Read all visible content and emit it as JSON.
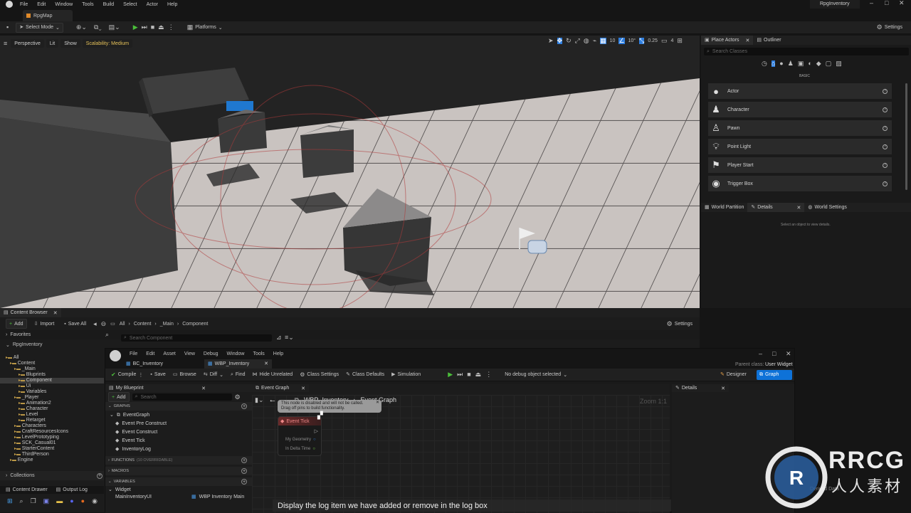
{
  "menubar": {
    "items": [
      "File",
      "Edit",
      "Window",
      "Tools",
      "Build",
      "Select",
      "Actor",
      "Help"
    ],
    "project": "RpgInventory"
  },
  "doc_tab": "RpgMap",
  "toolbar": {
    "select_mode": "Select Mode",
    "platforms": "Platforms",
    "settings": "Settings"
  },
  "viewport": {
    "perspective": "Perspective",
    "lit": "Lit",
    "show": "Show",
    "scalability": "Scalability: Medium",
    "grid_snap": "10",
    "rot_snap": "10°",
    "scale_snap": "0.25",
    "cam_speed": "4"
  },
  "place_actors": {
    "tab": "Place Actors",
    "outliner": "Outliner",
    "search_placeholder": "Search Classes",
    "section": "BASIC",
    "items": [
      {
        "label": "Actor",
        "icon": "actor-icon"
      },
      {
        "label": "Character",
        "icon": "character-icon"
      },
      {
        "label": "Pawn",
        "icon": "pawn-icon"
      },
      {
        "label": "Point Light",
        "icon": "point-light-icon"
      },
      {
        "label": "Player Start",
        "icon": "player-start-icon"
      },
      {
        "label": "Trigger Box",
        "icon": "trigger-box-icon"
      }
    ]
  },
  "lower_right": {
    "tabs": [
      "World Partition",
      "Details",
      "World Settings"
    ],
    "empty": "Select an object to view details."
  },
  "content_browser": {
    "tab": "Content Browser",
    "add": "Add",
    "import": "Import",
    "save_all": "Save All",
    "path": [
      "All",
      "Content",
      "_Main",
      "Component"
    ],
    "settings": "Settings",
    "search_placeholder": "Search Component",
    "favorites": "Favorites",
    "root": "RpgInventory",
    "tree": [
      {
        "label": "All",
        "d": 0
      },
      {
        "label": "Content",
        "d": 1
      },
      {
        "label": "_Main",
        "d": 2
      },
      {
        "label": "Bluprints",
        "d": 3
      },
      {
        "label": "Component",
        "d": 3,
        "sel": true
      },
      {
        "label": "Ui",
        "d": 3
      },
      {
        "label": "Variables",
        "d": 3
      },
      {
        "label": "_Player",
        "d": 2
      },
      {
        "label": "Animation2",
        "d": 3
      },
      {
        "label": "Character",
        "d": 3
      },
      {
        "label": "Level",
        "d": 3
      },
      {
        "label": "Retarget",
        "d": 3
      },
      {
        "label": "Characters",
        "d": 2
      },
      {
        "label": "CraftResourcesIcons",
        "d": 2
      },
      {
        "label": "LevelPrototyping",
        "d": 2
      },
      {
        "label": "SCK_Casual01",
        "d": 2
      },
      {
        "label": "StarterContent",
        "d": 2
      },
      {
        "label": "ThirdPerson",
        "d": 2
      },
      {
        "label": "Engine",
        "d": 1
      }
    ],
    "collections": "Collections",
    "content_drawer": "Content Drawer",
    "output_log": "Output Log"
  },
  "blueprint": {
    "menu": [
      "File",
      "Edit",
      "Asset",
      "View",
      "Debug",
      "Window",
      "Tools",
      "Help"
    ],
    "parent_class_label": "Parent class:",
    "parent_class": "User Widget",
    "tabs": [
      "BC_Inventory",
      "WBP_Inventory"
    ],
    "toolbar": [
      "Compile",
      "Save",
      "Browse",
      "Diff",
      "Find",
      "Hide Unrelated",
      "Class Settings",
      "Class Defaults",
      "Simulation"
    ],
    "debug": "No debug object selected",
    "designer": "Designer",
    "graph": "Graph",
    "my_blueprint": "My Blueprint",
    "add": "Add",
    "search": "Search",
    "graphs_head": "GRAPHS",
    "event_graph": "EventGraph",
    "events": [
      "Event Pre Construct",
      "Event Construct",
      "Event Tick",
      "InventoryLog"
    ],
    "functions_head": "FUNCTIONS",
    "functions_note": "(10 OVERRIDABLE)",
    "macros_head": "MACROS",
    "variables_head": "VARIABLES",
    "widget": "Widget",
    "var_item": "MainInventoryUI",
    "var_type": "WBP Inventory Main",
    "graph_tab": "Event Graph",
    "breadcrumb": [
      "WBP_Inventory",
      "Event Graph"
    ],
    "zoom": "Zoom 1:1",
    "node": {
      "tooltip1": "This node is disabled and will not be called.",
      "tooltip2": "Drag off pins to build functionality.",
      "title": "Event Tick",
      "pin1": "My Geometry",
      "pin2": "In Delta Time"
    },
    "details": "Details"
  },
  "caption": "Display the log item we have added or remove in the log box",
  "watermark": {
    "text1": "RRCG",
    "text2": "人人素材",
    "faint": "Derived Data"
  },
  "colors": {
    "accent": "#2f7fe0",
    "play": "#4bbf3a",
    "graph_active": "#0e72d8"
  }
}
